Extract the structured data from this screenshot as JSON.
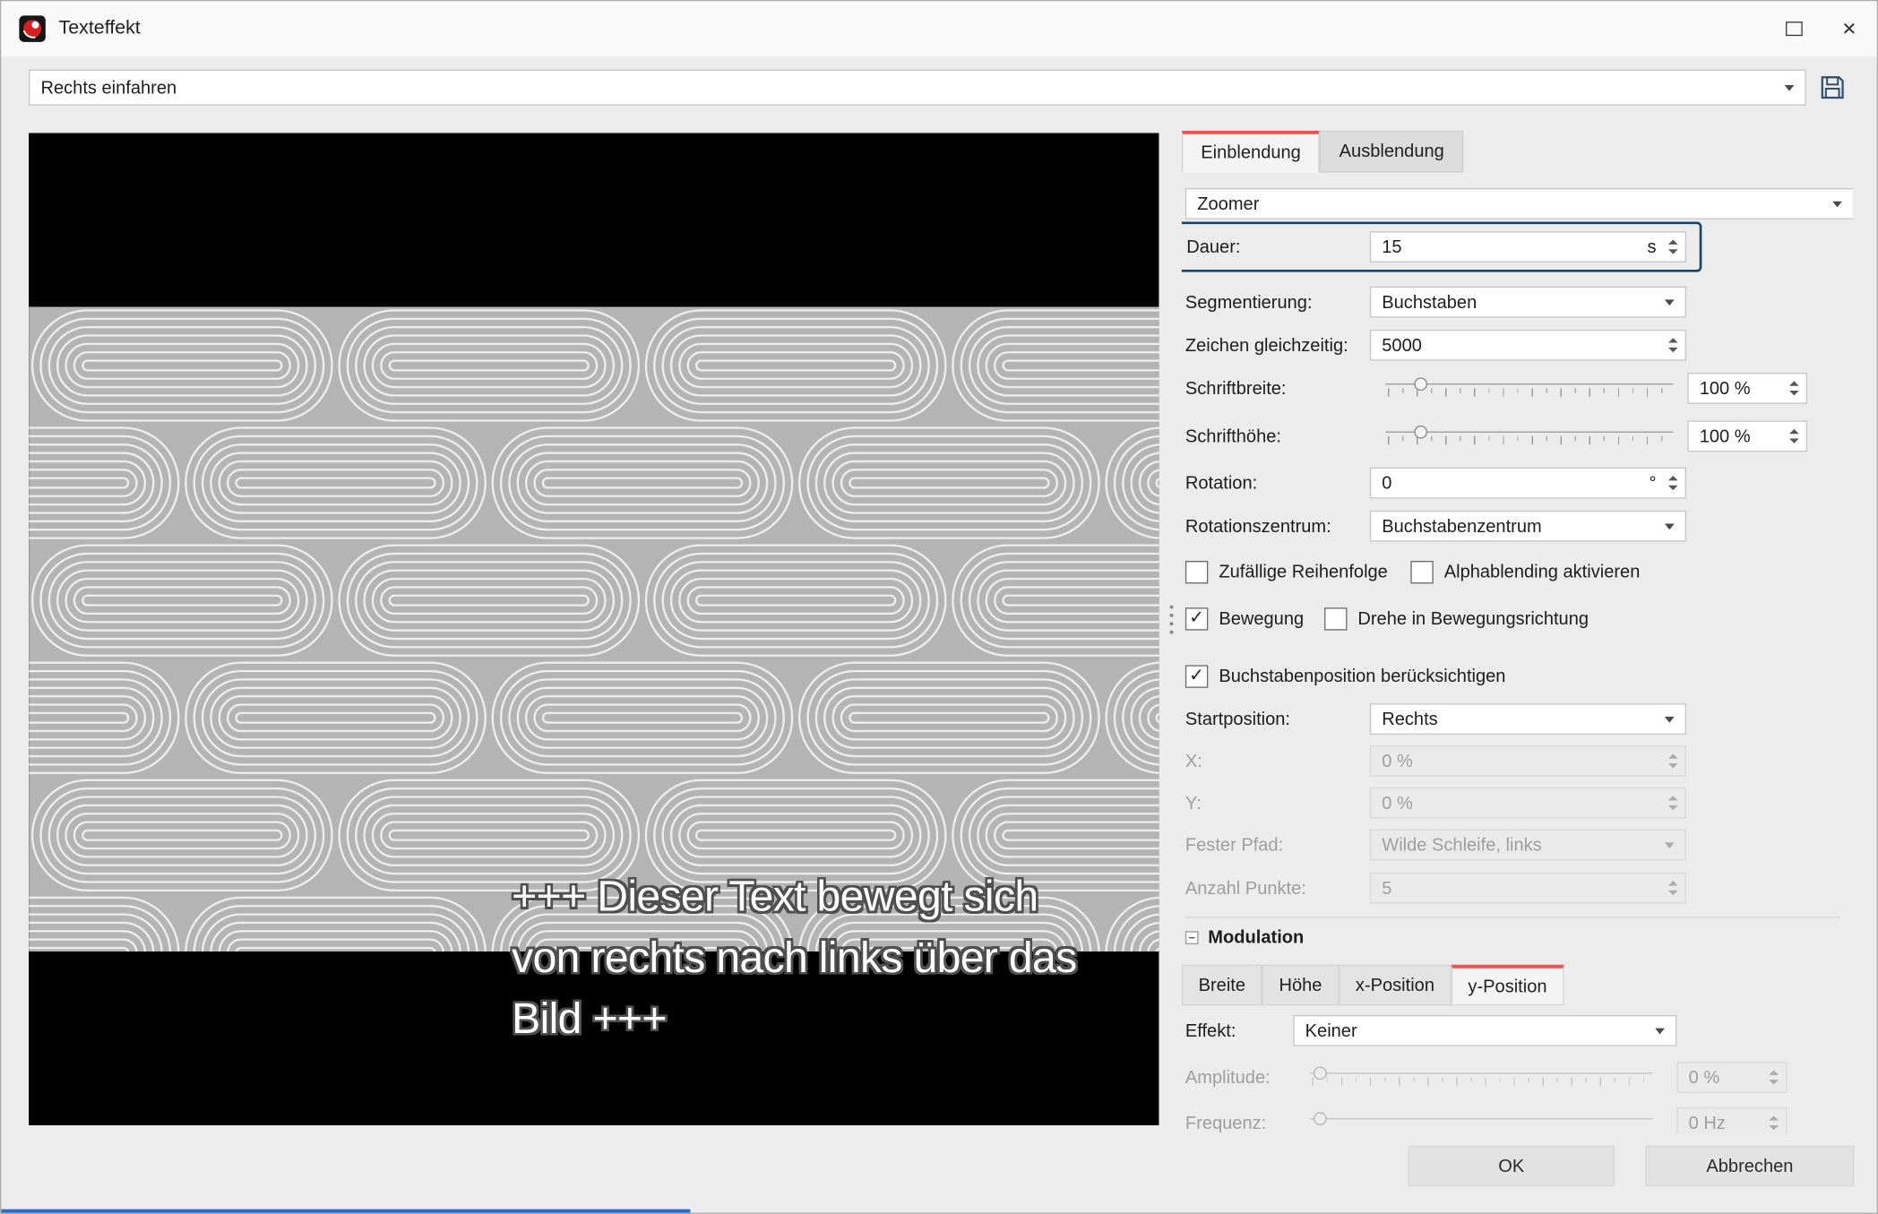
{
  "icons": {
    "close": "✕",
    "check": "✓"
  },
  "window": {
    "title": "Texteffekt"
  },
  "preset": {
    "value": "Rechts einfahren"
  },
  "preview": {
    "lines": [
      "+++ Dieser Text bewegt sich",
      "von rechts nach links über das",
      "Bild +++"
    ]
  },
  "panel": {
    "tabs": {
      "einblendung": "Einblendung",
      "ausblendung": "Ausblendung"
    },
    "animation": "Zoomer",
    "dauer": {
      "label": "Dauer:",
      "value": "15",
      "unit": "s"
    },
    "segmentierung": {
      "label": "Segmentierung:",
      "value": "Buchstaben"
    },
    "zeichen": {
      "label": "Zeichen gleichzeitig:",
      "value": "5000"
    },
    "schriftbreite": {
      "label": "Schriftbreite:",
      "value": "100 %"
    },
    "schrifthoehe": {
      "label": "Schrifthöhe:",
      "value": "100 %"
    },
    "rotation": {
      "label": "Rotation:",
      "value": "0",
      "unit": "°"
    },
    "rotationszentrum": {
      "label": "Rotationszentrum:",
      "value": "Buchstabenzentrum"
    },
    "cb_zufaellig": {
      "label": "Zufällige Reihenfolge",
      "checked": false
    },
    "cb_alphablending": {
      "label": "Alphablending aktivieren",
      "checked": false
    },
    "cb_bewegung": {
      "label": "Bewegung",
      "checked": true
    },
    "cb_drehe": {
      "label": "Drehe in Bewegungsrichtung",
      "checked": false
    },
    "cb_buchstabenposition": {
      "label": "Buchstabenposition berücksichtigen",
      "checked": true
    },
    "startposition": {
      "label": "Startposition:",
      "value": "Rechts"
    },
    "x": {
      "label": "X:",
      "value": "0 %"
    },
    "y": {
      "label": "Y:",
      "value": "0 %"
    },
    "fester_pfad": {
      "label": "Fester Pfad:",
      "value": "Wilde Schleife, links"
    },
    "anzahl_punkte": {
      "label": "Anzahl Punkte:",
      "value": "5"
    },
    "modulation": {
      "title": "Modulation",
      "tabs": {
        "breite": "Breite",
        "hoehe": "Höhe",
        "x_position": "x-Position",
        "y_position": "y-Position"
      },
      "effekt": {
        "label": "Effekt:",
        "value": "Keiner"
      },
      "amplitude": {
        "label": "Amplitude:",
        "value": "0 %"
      },
      "frequenz": {
        "label": "Frequenz:",
        "value": "0 Hz"
      }
    }
  },
  "footer": {
    "ok": "OK",
    "cancel": "Abbrechen"
  },
  "colors": {
    "accent_red": "#f0534f",
    "highlight_border": "#17476b",
    "preview_gray": "#b4b4b4"
  }
}
